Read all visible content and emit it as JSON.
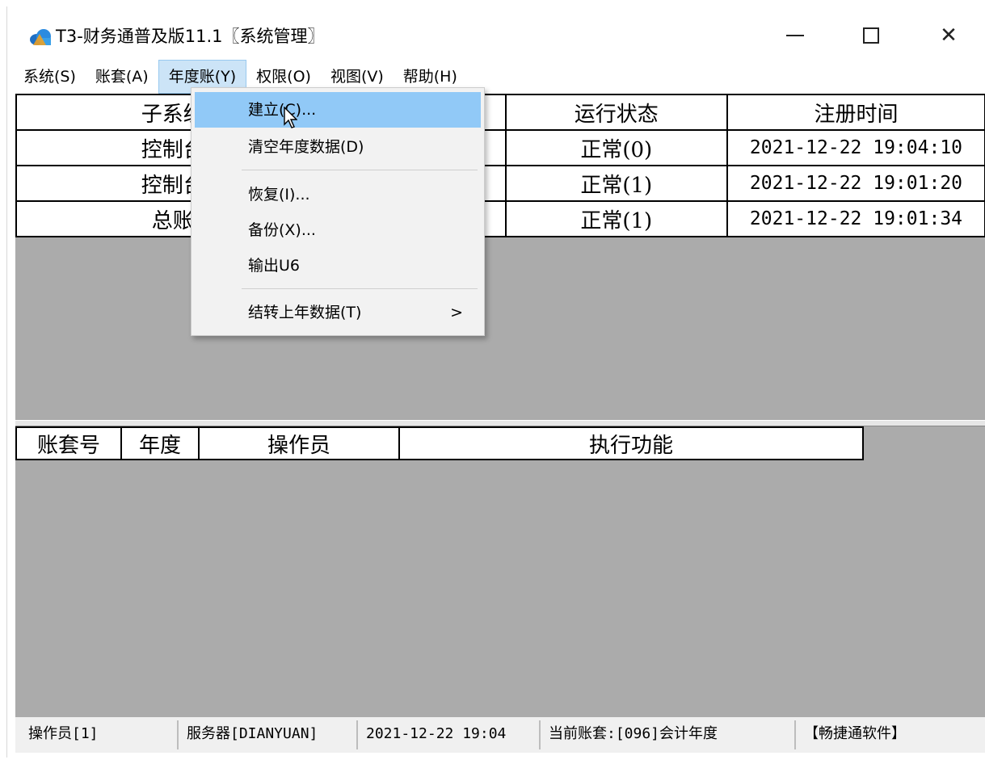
{
  "window": {
    "title": "T3-财务通普及版11.1〖系统管理〗",
    "controls": {
      "minimize": "—",
      "maximize": "□",
      "close": "✕"
    }
  },
  "menubar": {
    "items": [
      {
        "label": "系统(S)"
      },
      {
        "label": "账套(A)"
      },
      {
        "label": "年度账(Y)",
        "open": true
      },
      {
        "label": "权限(O)"
      },
      {
        "label": "视图(V)"
      },
      {
        "label": "帮助(H)"
      }
    ]
  },
  "dropdown": {
    "items": [
      {
        "label": "建立(C)...",
        "highlighted": true
      },
      {
        "label": "清空年度数据(D)"
      },
      {
        "label": "恢复(I)..."
      },
      {
        "label": "备份(X)..."
      },
      {
        "label": "输出U6"
      },
      {
        "label": "结转上年数据(T)",
        "submenu_arrow": ">"
      }
    ]
  },
  "upper_table": {
    "headers": [
      "子系统",
      "",
      "运行状态",
      "注册时间"
    ],
    "rows": [
      {
        "subsystem": "控制台",
        "status": "正常(0)",
        "time": "2021-12-22 19:04:10"
      },
      {
        "subsystem": "控制台",
        "status": "正常(1)",
        "time": "2021-12-22 19:01:20"
      },
      {
        "subsystem": "总账",
        "status": "正常(1)",
        "time": "2021-12-22 19:01:34"
      }
    ]
  },
  "lower_table": {
    "headers": [
      "账套号",
      "年度",
      "操作员",
      "执行功能"
    ]
  },
  "statusbar": {
    "operator": "操作员[1]",
    "server": "服务器[DIANYUAN]",
    "datetime": "2021-12-22 19:04",
    "current_account": "当前账套:[096]会计年度",
    "extra": "【畅捷通软件】"
  },
  "colors": {
    "grid_background": "#ababab",
    "menu_highlight": "#91c9f7",
    "menu_open": "#cce4f7"
  }
}
